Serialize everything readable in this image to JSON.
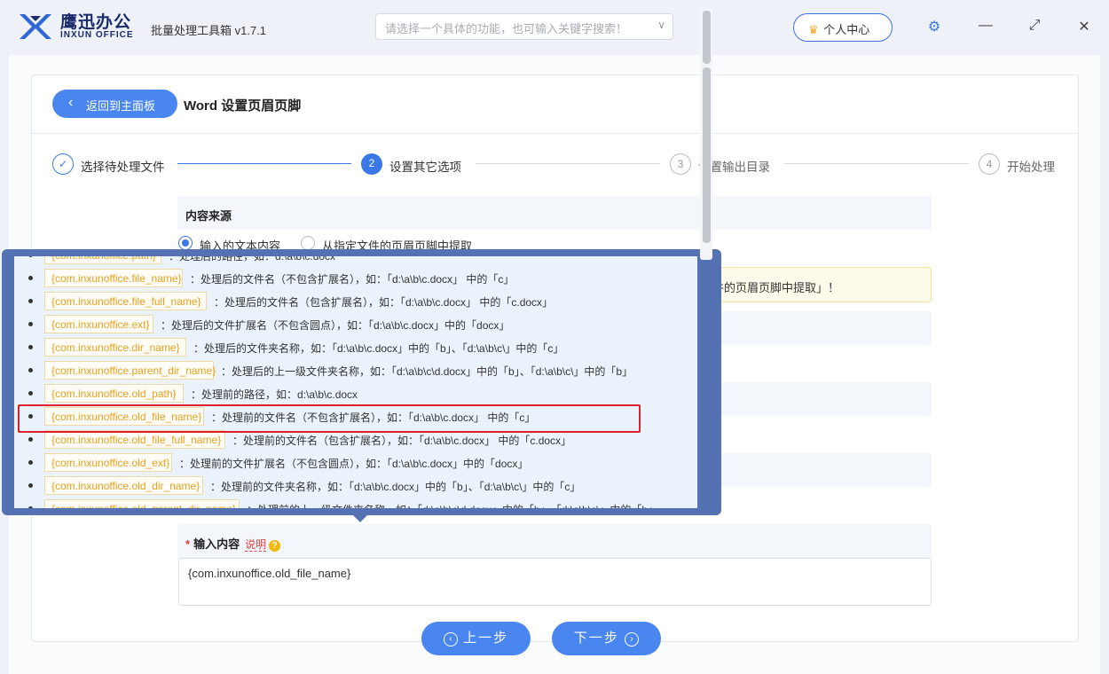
{
  "brand": {
    "name_cn": "鹰迅办公",
    "name_en": "INXUN OFFICE"
  },
  "app": {
    "title": "批量处理工具箱 v1.7.1"
  },
  "search": {
    "placeholder": "请选择一个具体的功能，也可输入关键字搜索！"
  },
  "header": {
    "user_center": "个人中心"
  },
  "page": {
    "back": "返回到主面板",
    "title": "Word 设置页眉页脚"
  },
  "steps": [
    {
      "num": "✓",
      "label": "选择待处理文件"
    },
    {
      "num": "2",
      "label": "设置其它选项"
    },
    {
      "num": "3",
      "label": "设置输出目录"
    },
    {
      "num": "4",
      "label": "开始处理"
    }
  ],
  "content_source": {
    "title": "内容来源",
    "options": [
      "输入的文本内容",
      "从指定文件的页眉页脚中提取"
    ],
    "selected": 0,
    "warning_tail": "件的页眉页脚中提取」！"
  },
  "variables": [
    {
      "tag": "{com.inxunoffice.path}",
      "desc": "：处理后的路径，如：d:\\a\\b\\c.docx"
    },
    {
      "tag": "{com.inxunoffice.file_name}",
      "desc": "：处理后的文件名（不包含扩展名），如：「d:\\a\\b\\c.docx」 中的「c」"
    },
    {
      "tag": "{com.inxunoffice.file_full_name}",
      "desc": "：处理后的文件名（包含扩展名），如：「d:\\a\\b\\c.docx」 中的「c.docx」"
    },
    {
      "tag": "{com.inxunoffice.ext}",
      "desc": "：处理后的文件扩展名（不包含圆点），如：「d:\\a\\b\\c.docx」中的「docx」"
    },
    {
      "tag": "{com.inxunoffice.dir_name}",
      "desc": "：处理后的文件夹名称，如：「d:\\a\\b\\c.docx」中的「b」、「d:\\a\\b\\c\\」中的「c」"
    },
    {
      "tag": "{com.inxunoffice.parent_dir_name}",
      "desc": "：处理后的上一级文件夹名称，如：「d:\\a\\b\\c\\d.docx」中的「b」、「d:\\a\\b\\c\\」中的「b」"
    },
    {
      "tag": "{com.inxunoffice.old_path}",
      "desc": "：处理前的路径，如：d:\\a\\b\\c.docx"
    },
    {
      "tag": "{com.inxunoffice.old_file_name}",
      "desc": "：处理前的文件名（不包含扩展名），如：「d:\\a\\b\\c.docx」 中的「c」"
    },
    {
      "tag": "{com.inxunoffice.old_file_full_name}",
      "desc": "：处理前的文件名（包含扩展名），如：「d:\\a\\b\\c.docx」 中的「c.docx」"
    },
    {
      "tag": "{com.inxunoffice.old_ext}",
      "desc": "：处理前的文件扩展名（不包含圆点），如：「d:\\a\\b\\c.docx」中的「docx」"
    },
    {
      "tag": "{com.inxunoffice.old_dir_name}",
      "desc": "：处理前的文件夹名称，如：「d:\\a\\b\\c.docx」中的「b」、「d:\\a\\b\\c\\」中的「c」"
    },
    {
      "tag": "{com.inxunoffice.old_parent_dir_name}",
      "desc": "：处理前的上一级文件夹名称，如：「d:\\a\\b\\c\\d.docx」中的「b」、「d:\\a\\b\\c\\」中的「b」"
    }
  ],
  "input": {
    "label": "输入内容",
    "explain": "说明",
    "value": "{com.inxunoffice.old_file_name}"
  },
  "nav": {
    "prev": "上一步",
    "next": "下一步"
  },
  "colors": {
    "accent": "#4a86f0",
    "tag_text": "#e8a020",
    "highlight": "#e0202a",
    "popup_frame": "#5471b4"
  }
}
